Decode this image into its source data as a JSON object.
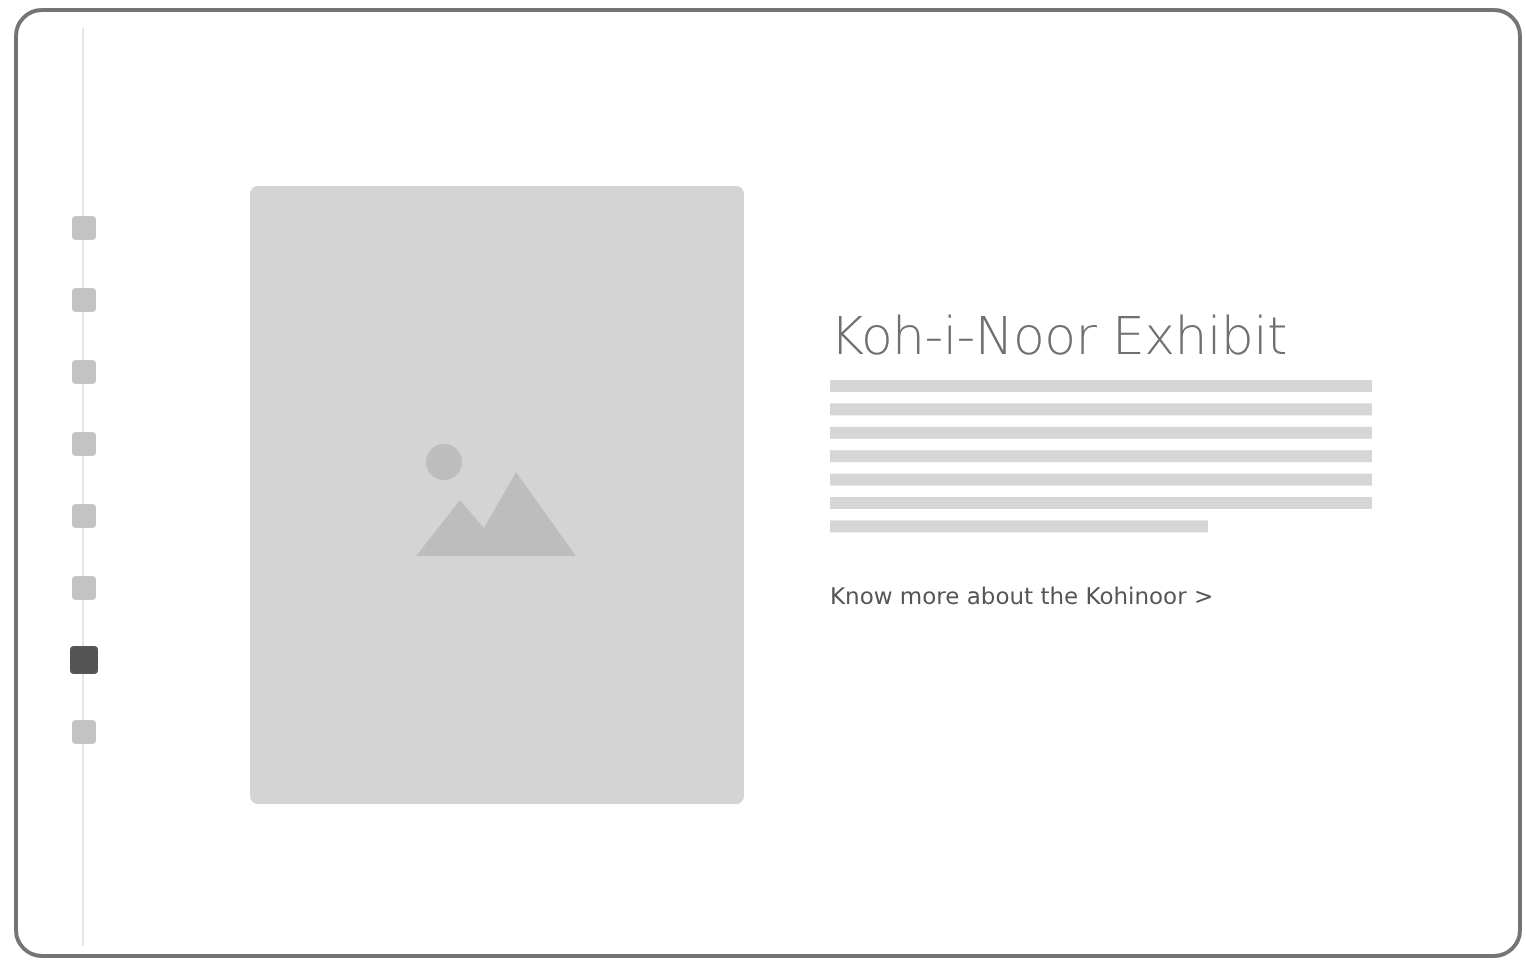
{
  "nav": [
    {
      "selected": false
    },
    {
      "selected": false
    },
    {
      "selected": false
    },
    {
      "selected": false
    },
    {
      "selected": false
    },
    {
      "selected": false
    },
    {
      "selected": true
    },
    {
      "selected": false
    }
  ],
  "exhibit": {
    "title": "Koh-i-Noor Exhibit",
    "link": "Know more about the Kohinoor >"
  }
}
